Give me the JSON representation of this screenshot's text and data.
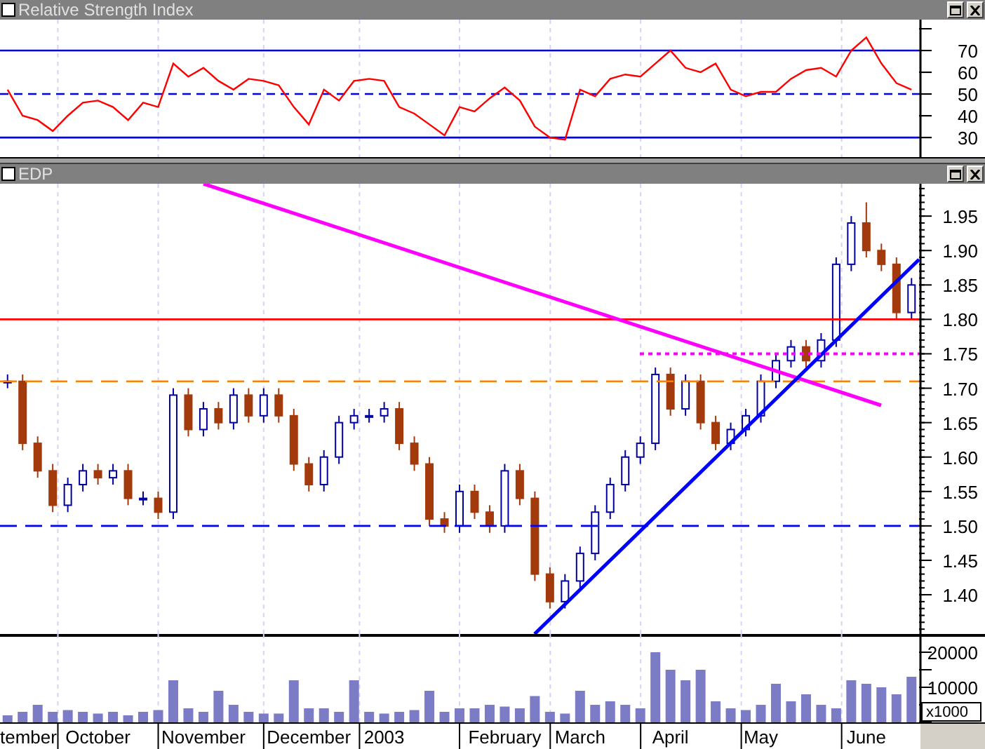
{
  "rsi_panel": {
    "title": "Relative Strength Index",
    "chart_data": {
      "type": "line",
      "grid": true,
      "ylim": [
        21,
        84.2
      ],
      "yticks": [
        30,
        40,
        50,
        60,
        70
      ],
      "categories": [
        null,
        null,
        null,
        null,
        null,
        null,
        null,
        null,
        null,
        null,
        null,
        null,
        null,
        null,
        null,
        null,
        null,
        null,
        null,
        null,
        null,
        null,
        null,
        null,
        null,
        null,
        null,
        null,
        null,
        null,
        null,
        null,
        null,
        null,
        null,
        null,
        null,
        null,
        null,
        null,
        null,
        null,
        null,
        null,
        null,
        null,
        null,
        null,
        null,
        null,
        null,
        null,
        null,
        null,
        null,
        null,
        null,
        null,
        null,
        null,
        null
      ],
      "series": [
        {
          "color": "#ff0000",
          "values": [
            52,
            40,
            38,
            33,
            40,
            46,
            47,
            44,
            38,
            46,
            44,
            64,
            58,
            62,
            56,
            52,
            57,
            56,
            54,
            44,
            36,
            52,
            47,
            56,
            57,
            56,
            44,
            41,
            36,
            31,
            44,
            42,
            48,
            53,
            47,
            35,
            30,
            29,
            52,
            49,
            57,
            59,
            58,
            64,
            70,
            62,
            60,
            64,
            52,
            49,
            51,
            51,
            57,
            61,
            62,
            58,
            70,
            76,
            64,
            55,
            52
          ]
        }
      ],
      "ref_lines": [
        {
          "axis": "y",
          "value": 70,
          "color": "#0000ff"
        },
        {
          "axis": "y",
          "value": 50,
          "color": "#0000ff"
        },
        {
          "axis": "y",
          "value": 30,
          "color": "#0000ff"
        }
      ]
    }
  },
  "price_panel": {
    "title": "EDP",
    "trend_lines": [
      {
        "color": "#ff00ff"
      },
      {
        "color": "#0000ff"
      },
      {
        "color": "#ff00ff"
      }
    ],
    "chart_data": {
      "type": "candlestick",
      "grid": true,
      "ylim": [
        1.343,
        1.997
      ],
      "yticks": [
        {
          "value": 1.4,
          "label": "1.40"
        },
        {
          "value": 1.45,
          "label": "1.45"
        },
        {
          "value": 1.5,
          "label": "1.50"
        },
        {
          "value": 1.55,
          "label": "1.55"
        },
        {
          "value": 1.6,
          "label": "1.60"
        },
        {
          "value": 1.65,
          "label": "1.65"
        },
        {
          "value": 1.7,
          "label": "1.70"
        },
        {
          "value": 1.75,
          "label": "1.75"
        },
        {
          "value": 1.8,
          "label": "1.80"
        },
        {
          "value": 1.85,
          "label": "1.85"
        },
        {
          "value": 1.9,
          "label": "1.90"
        },
        {
          "value": 1.95,
          "label": "1.95"
        }
      ],
      "categories": [
        null,
        null,
        null,
        null,
        null,
        null,
        null,
        null,
        null,
        null,
        null,
        null,
        null,
        null,
        null,
        null,
        null,
        null,
        null,
        null,
        null,
        null,
        null,
        null,
        null,
        null,
        null,
        null,
        null,
        null,
        null,
        null,
        null,
        null,
        null,
        null,
        null,
        null,
        null,
        null,
        null,
        null,
        null,
        null,
        null,
        null,
        null,
        null,
        null,
        null,
        null,
        null,
        null,
        null,
        null,
        null,
        null,
        null,
        null,
        null,
        null
      ],
      "ohlc": [
        [
          1.71,
          1.72,
          1.7,
          1.71
        ],
        [
          1.71,
          1.72,
          1.61,
          1.62
        ],
        [
          1.62,
          1.63,
          1.57,
          1.58
        ],
        [
          1.58,
          1.59,
          1.52,
          1.53
        ],
        [
          1.53,
          1.57,
          1.52,
          1.56
        ],
        [
          1.56,
          1.59,
          1.55,
          1.58
        ],
        [
          1.58,
          1.59,
          1.56,
          1.57
        ],
        [
          1.57,
          1.59,
          1.56,
          1.58
        ],
        [
          1.58,
          1.59,
          1.53,
          1.54
        ],
        [
          1.54,
          1.55,
          1.53,
          1.54
        ],
        [
          1.54,
          1.55,
          1.51,
          1.52
        ],
        [
          1.52,
          1.7,
          1.51,
          1.69
        ],
        [
          1.69,
          1.7,
          1.63,
          1.64
        ],
        [
          1.64,
          1.68,
          1.63,
          1.67
        ],
        [
          1.67,
          1.68,
          1.64,
          1.65
        ],
        [
          1.65,
          1.7,
          1.64,
          1.69
        ],
        [
          1.69,
          1.7,
          1.65,
          1.66
        ],
        [
          1.66,
          1.7,
          1.65,
          1.69
        ],
        [
          1.69,
          1.7,
          1.65,
          1.66
        ],
        [
          1.66,
          1.67,
          1.58,
          1.59
        ],
        [
          1.59,
          1.6,
          1.55,
          1.56
        ],
        [
          1.56,
          1.61,
          1.55,
          1.6
        ],
        [
          1.6,
          1.66,
          1.59,
          1.65
        ],
        [
          1.65,
          1.67,
          1.64,
          1.66
        ],
        [
          1.66,
          1.67,
          1.65,
          1.66
        ],
        [
          1.66,
          1.68,
          1.65,
          1.67
        ],
        [
          1.67,
          1.68,
          1.61,
          1.62
        ],
        [
          1.62,
          1.63,
          1.58,
          1.59
        ],
        [
          1.59,
          1.6,
          1.5,
          1.51
        ],
        [
          1.51,
          1.52,
          1.49,
          1.5
        ],
        [
          1.5,
          1.56,
          1.49,
          1.55
        ],
        [
          1.55,
          1.56,
          1.51,
          1.52
        ],
        [
          1.52,
          1.53,
          1.49,
          1.5
        ],
        [
          1.5,
          1.59,
          1.49,
          1.58
        ],
        [
          1.58,
          1.59,
          1.53,
          1.54
        ],
        [
          1.54,
          1.55,
          1.42,
          1.43
        ],
        [
          1.43,
          1.44,
          1.38,
          1.39
        ],
        [
          1.39,
          1.43,
          1.38,
          1.42
        ],
        [
          1.42,
          1.47,
          1.41,
          1.46
        ],
        [
          1.46,
          1.53,
          1.45,
          1.52
        ],
        [
          1.52,
          1.57,
          1.51,
          1.56
        ],
        [
          1.56,
          1.61,
          1.55,
          1.6
        ],
        [
          1.6,
          1.63,
          1.59,
          1.62
        ],
        [
          1.62,
          1.73,
          1.61,
          1.72
        ],
        [
          1.72,
          1.73,
          1.66,
          1.67
        ],
        [
          1.67,
          1.72,
          1.66,
          1.71
        ],
        [
          1.71,
          1.72,
          1.64,
          1.65
        ],
        [
          1.65,
          1.66,
          1.61,
          1.62
        ],
        [
          1.62,
          1.65,
          1.61,
          1.64
        ],
        [
          1.64,
          1.67,
          1.63,
          1.66
        ],
        [
          1.66,
          1.72,
          1.65,
          1.71
        ],
        [
          1.71,
          1.75,
          1.7,
          1.74
        ],
        [
          1.74,
          1.77,
          1.73,
          1.76
        ],
        [
          1.76,
          1.77,
          1.73,
          1.74
        ],
        [
          1.74,
          1.78,
          1.73,
          1.77
        ],
        [
          1.77,
          1.89,
          1.76,
          1.88
        ],
        [
          1.88,
          1.95,
          1.87,
          1.94
        ],
        [
          1.94,
          1.97,
          1.89,
          1.9
        ],
        [
          1.9,
          1.91,
          1.87,
          1.88
        ],
        [
          1.88,
          1.89,
          1.8,
          1.81
        ],
        [
          1.81,
          1.86,
          1.8,
          1.85
        ]
      ],
      "ref_lines": [
        {
          "axis": "y",
          "value": 1.8,
          "color": "#ff0000"
        },
        {
          "axis": "y",
          "value": 1.71,
          "color": "#ff8000"
        },
        {
          "axis": "y",
          "value": 1.5,
          "color": "#0000ff"
        }
      ]
    }
  },
  "volume_panel": {
    "scale_label": "x1000",
    "chart_data": {
      "type": "bar",
      "grid": true,
      "ylim": [
        0,
        25200
      ],
      "yticks": [
        {
          "value": 10000,
          "label": "10000"
        },
        {
          "value": 20000,
          "label": "20000"
        }
      ],
      "categories": [
        null,
        "tember",
        null,
        null,
        null,
        null,
        "October",
        null,
        null,
        null,
        null,
        null,
        null,
        "November",
        null,
        null,
        null,
        null,
        null,
        null,
        "December",
        null,
        null,
        null,
        null,
        "2003",
        null,
        null,
        null,
        null,
        null,
        null,
        null,
        "February",
        null,
        null,
        null,
        null,
        "March",
        null,
        null,
        null,
        null,
        null,
        "April",
        null,
        null,
        null,
        null,
        null,
        "May",
        null,
        null,
        null,
        null,
        null,
        null,
        "June",
        null,
        null,
        null
      ],
      "series": [
        {
          "color": "#7b7bc6",
          "values": [
            2000,
            3000,
            5000,
            3000,
            3500,
            3000,
            2500,
            3000,
            2000,
            3000,
            3500,
            12000,
            4000,
            3000,
            9000,
            5000,
            3000,
            2500,
            2500,
            12000,
            4000,
            4000,
            3000,
            12000,
            3000,
            2500,
            3000,
            3500,
            9000,
            3000,
            4000,
            4000,
            5000,
            4500,
            4000,
            7500,
            3000,
            2500,
            9000,
            5000,
            6000,
            5000,
            4000,
            20000,
            15000,
            12000,
            15000,
            6000,
            4000,
            3500,
            5000,
            11000,
            6000,
            8000,
            5000,
            4000,
            12000,
            11000,
            10000,
            8000,
            13000
          ]
        }
      ]
    }
  }
}
